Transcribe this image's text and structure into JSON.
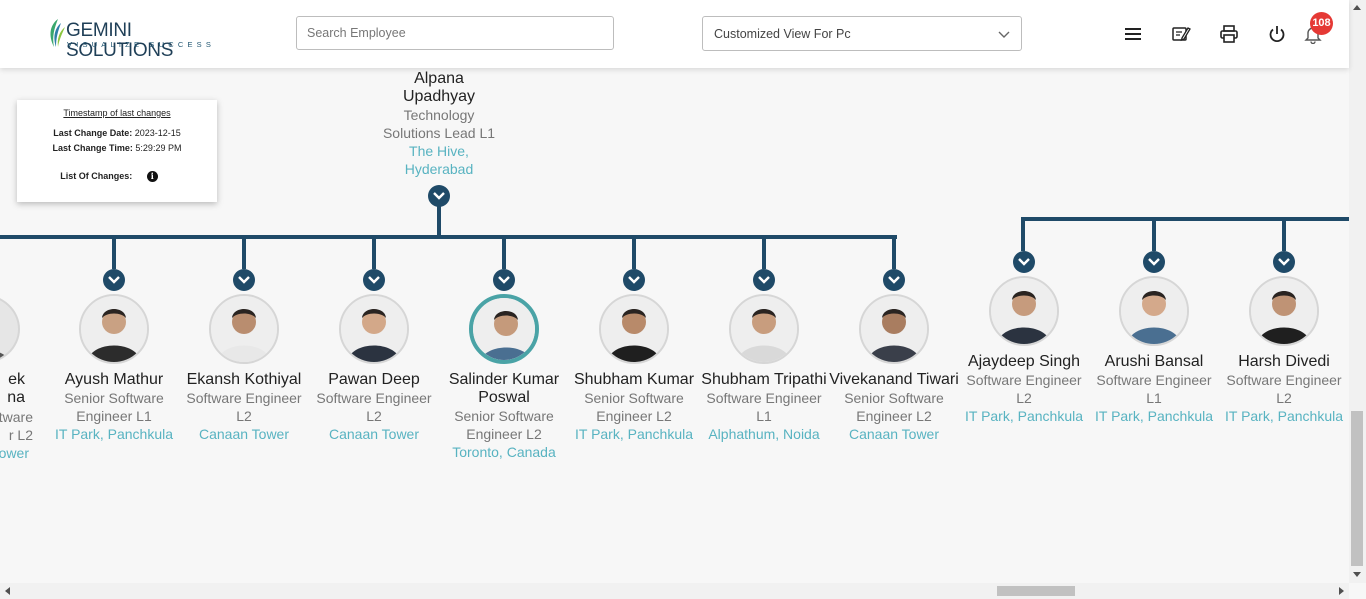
{
  "header": {
    "logo_text": "GEMINI SOLUTIONS",
    "logo_tagline": "VISUALIZE SUCCESS",
    "search_placeholder": "Search Employee",
    "view_select_value": "Customized View For Pc",
    "notification_count": "108",
    "icons": [
      "menu-icon",
      "edit-note-icon",
      "printer-icon",
      "power-icon",
      "bell-icon"
    ]
  },
  "timestamp_card": {
    "title": "Timestamp of last changes",
    "date_label": "Last Change Date:",
    "date_value": "2023-12-15",
    "time_label": "Last Change Time:",
    "time_value": "5:29:29 PM",
    "changes_label": "List Of Changes:"
  },
  "manager": {
    "name": "Alpana Upadhyay",
    "title": "Technology Solutions Lead L1",
    "location": "The Hive, Hyderabad"
  },
  "partial_person": {
    "name": "ek na",
    "title": "ftware r L2",
    "location": "ower"
  },
  "reports": [
    {
      "name": "Ayush Mathur",
      "title": "Senior Software Engineer L1",
      "location": "IT Park, Panchkula"
    },
    {
      "name": "Ekansh Kothiyal",
      "title": "Software Engineer L2",
      "location": "Canaan Tower"
    },
    {
      "name": "Pawan Deep",
      "title": "Software Engineer L2",
      "location": "Canaan Tower"
    },
    {
      "name": "Salinder Kumar Poswal",
      "title": "Senior Software Engineer L2",
      "location": "Toronto, Canada"
    },
    {
      "name": "Shubham Kumar",
      "title": "Senior Software Engineer L2",
      "location": "IT Park, Panchkula"
    },
    {
      "name": "Shubham Tripathi",
      "title": "Software Engineer L1",
      "location": "Alphathum, Noida"
    },
    {
      "name": "Vivekanand Tiwari",
      "title": "Senior Software Engineer L2",
      "location": "Canaan Tower"
    }
  ],
  "right_group": [
    {
      "name": "Ajaydeep Singh",
      "title": "Software Engineer L2",
      "location": "IT Park, Panchkula"
    },
    {
      "name": "Arushi Bansal",
      "title": "Software Engineer L1",
      "location": "IT Park, Panchkula"
    },
    {
      "name": "Harsh Divedi",
      "title": "Software Engineer L2",
      "location": "IT Park, Panchkula"
    }
  ],
  "colors": {
    "connector": "#1f4a68",
    "location_text": "#58b3c1",
    "highlight_ring": "#4aa3a6",
    "badge": "#e53935"
  }
}
